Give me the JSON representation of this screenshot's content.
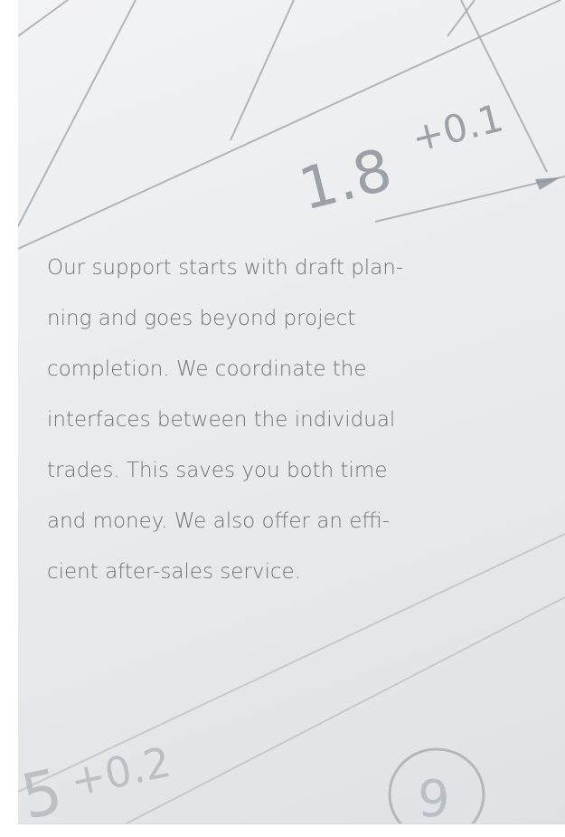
{
  "panel": {
    "text_lines": [
      "Our support starts with draft plan-",
      "ning and goes beyond project",
      "completion. We coordinate the",
      "interfaces between the individual",
      "trades. This saves you both time",
      "and money. We also offer an effi-",
      "cient after-sales service."
    ],
    "drawing": {
      "dimension_main": "1.8",
      "tolerance_main": "+0.1",
      "dimension_lower": "5",
      "tolerance_lower": "+0.2",
      "circle_mark": "9"
    }
  },
  "colors": {
    "text": "#6f7378",
    "drawing_lines": "#9aa1a8",
    "panel_bg": "#ebedef"
  }
}
